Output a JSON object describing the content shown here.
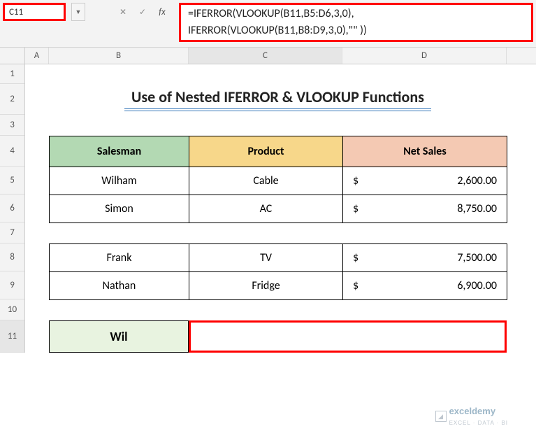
{
  "nameBox": "C11",
  "formula": {
    "line1": "=IFERROR(VLOOKUP(B11,B5:D6,3,0),",
    "line2": "IFERROR(VLOOKUP(B11,B8:D9,3,0),\"\" ))"
  },
  "columns": [
    "A",
    "B",
    "C",
    "D"
  ],
  "rows": [
    "1",
    "2",
    "3",
    "4",
    "5",
    "6",
    "7",
    "8",
    "9",
    "10",
    "11"
  ],
  "title": "Use of Nested IFERROR & VLOOKUP Functions",
  "headers": {
    "salesman": "Salesman",
    "product": "Product",
    "netsales": "Net Sales"
  },
  "table1": [
    {
      "salesman": "Wilham",
      "product": "Cable",
      "cur": "$",
      "net": "2,600.00"
    },
    {
      "salesman": "Simon",
      "product": "AC",
      "cur": "$",
      "net": "8,750.00"
    }
  ],
  "table2": [
    {
      "salesman": "Frank",
      "product": "TV",
      "cur": "$",
      "net": "7,500.00"
    },
    {
      "salesman": "Nathan",
      "product": "Fridge",
      "cur": "$",
      "net": "6,900.00"
    }
  ],
  "inputB11": "Wil",
  "watermark": {
    "brand": "exceldemy",
    "tag": "EXCEL · DATA · BI"
  },
  "icons": {
    "dropdown": "▼",
    "cancel": "✕",
    "enter": "✓",
    "fx": "fx"
  }
}
